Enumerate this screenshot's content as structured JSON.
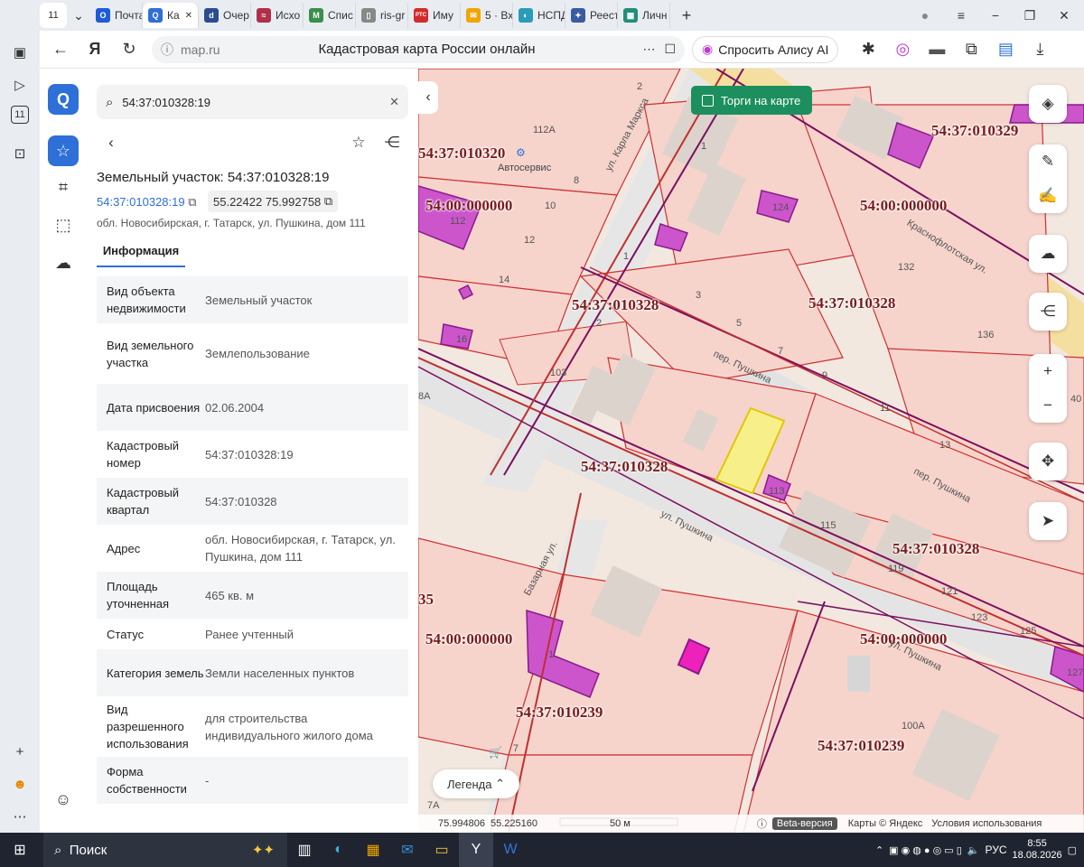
{
  "browser": {
    "tab_counter": "11",
    "tabs": [
      {
        "label": "Почта",
        "color": "#1e5bd6",
        "glyph": "O"
      },
      {
        "label": "Ка",
        "color": "#2e6fd8",
        "glyph": "Q"
      },
      {
        "label": "Очер",
        "color": "#2a4d8f",
        "glyph": "d"
      },
      {
        "label": "Исхо",
        "color": "#b0304a",
        "glyph": "≈"
      },
      {
        "label": "Спис",
        "color": "#3a8f4a",
        "glyph": "M"
      },
      {
        "label": "ris-gr",
        "color": "#888888",
        "glyph": "▯"
      },
      {
        "label": "Иму",
        "color": "#d22b2b",
        "glyph": "РТС"
      },
      {
        "label": "5 · Вх",
        "color": "#f0a500",
        "glyph": "✉"
      },
      {
        "label": "НСПД",
        "color": "#2a9bb8",
        "glyph": "◐"
      },
      {
        "label": "Реест",
        "color": "#3a5ba0",
        "glyph": "✦"
      },
      {
        "label": "Личн",
        "color": "#1f8f7a",
        "glyph": "▦"
      }
    ],
    "url": "map.ru",
    "page_title": "Кадастровая карта России онлайн",
    "alice_label": "Спросить Алису AI"
  },
  "panel": {
    "search_value": "54:37:010328:19",
    "title": "Земельный участок: 54:37:010328:19",
    "cadastral_link": "54:37:010328:19",
    "coords": "55.22422 75.992758",
    "address": "обл. Новосибирская, г. Татарск, ул. Пушкина, дом 111",
    "tab_info": "Информация",
    "rows": [
      {
        "k": "Вид объекта недвижимости",
        "v": "Земельный участок"
      },
      {
        "k": "Вид земельного участка",
        "v": "Землепользование"
      },
      {
        "k": "Дата присвоения",
        "v": "02.06.2004"
      },
      {
        "k": "Кадастровый номер",
        "v": "54:37:010328:19"
      },
      {
        "k": "Кадастровый квартал",
        "v": "54:37:010328"
      },
      {
        "k": "Адрес",
        "v": "обл. Новосибирская, г. Татарск, ул. Пушкина, дом 111"
      },
      {
        "k": "Площадь уточненная",
        "v": "465 кв. м"
      },
      {
        "k": "Статус",
        "v": "Ранее учтенный"
      },
      {
        "k": "Категория земель",
        "v": "Земли населенных пунктов"
      },
      {
        "k": "Вид разрешенного использования",
        "v": "для строительства индивидуального жилого дома"
      },
      {
        "k": "Форма собственности",
        "v": "-"
      }
    ]
  },
  "map": {
    "torgi_label": "Торги на карте",
    "legend_label": "Легенда",
    "labels": {
      "q010320": "54:37:010320",
      "q010329": "54:37:010329",
      "z1": "54:00:000000",
      "z2": "54:00:000000",
      "q010328a": "54:37:010328",
      "q010328b": "54:37:010328",
      "q010328c": "54:37:010328",
      "q010328d": "54:37:010328",
      "z3": "54:00:000000",
      "z4": "54:00:000000",
      "q010239a": "54:37:010239",
      "q010239b": "54:37:010239",
      "p35": "35"
    },
    "streets": {
      "marx": "ул. Карла Маркса",
      "krasnoflot": "Краснофлотская ул.",
      "pushkina_per1": "пер. Пушкина",
      "pushkina_per2": "пер. Пушкина",
      "pushkina_ul1": "ул. Пушкина",
      "pushkina_ul2": "ул. Пушкина",
      "bazarnaya": "Базарная ул."
    },
    "house_numbers": {
      "h2": "2",
      "h112a": "112А",
      "h8": "8",
      "h10": "10",
      "h112": "112",
      "h12": "12",
      "h14": "14",
      "h16": "16",
      "h103": "103",
      "h8a": "8А",
      "h1a": "1",
      "h124": "124",
      "h1b": "1",
      "h3": "3",
      "h2b": "2",
      "h5": "5",
      "h7": "7",
      "h9": "9",
      "h132": "132",
      "h11": "11",
      "h13": "13",
      "h136": "136",
      "h1c": "1",
      "h40": "40",
      "h113": "113",
      "h115": "115",
      "h119": "119",
      "h121": "121",
      "h123": "123",
      "h125": "125",
      "h127": "127",
      "h1d": "1",
      "h7b": "7",
      "h100a": "100А",
      "h7a": "7А",
      "h119b": "119"
    },
    "poi_autoservice": "Автосервис",
    "scale_label": "50 м",
    "cursor_lon": "75.994806",
    "cursor_lat": "55.225160",
    "beta": "Beta-версия",
    "copyright": "Карты © Яндекс",
    "terms": "Условия использования"
  },
  "taskbar": {
    "search": "Поиск",
    "lang": "РУС",
    "time": "8:55",
    "date": "18.08.2026"
  }
}
